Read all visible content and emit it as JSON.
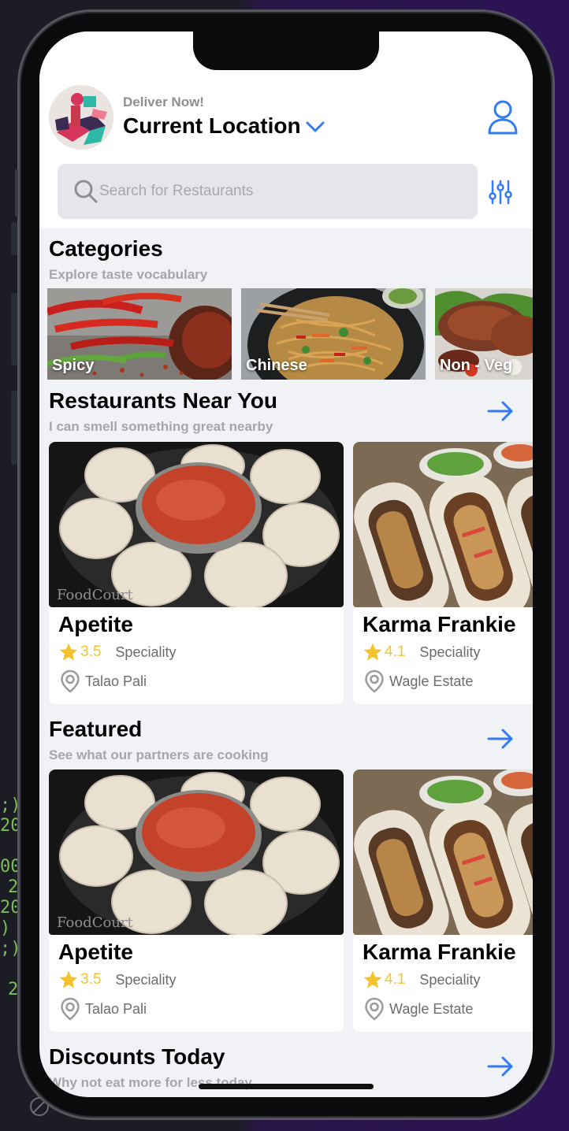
{
  "header": {
    "deliver_label": "Deliver Now!",
    "location": "Current Location",
    "search_placeholder": "Search for Restaurants"
  },
  "categories": {
    "title": "Categories",
    "subtitle": "Explore taste vocabulary",
    "items": [
      {
        "label": "Spicy"
      },
      {
        "label": "Chinese"
      },
      {
        "label": "Non - Veg"
      }
    ]
  },
  "nearby": {
    "title": "Restaurants Near You",
    "subtitle": "I can smell something great nearby",
    "cards": [
      {
        "name": "Apetite",
        "rating": "3.5",
        "tag": "Speciality",
        "location": "Talao Pali"
      },
      {
        "name": "Karma Frankie",
        "rating": "4.1",
        "tag": "Speciality",
        "location": "Wagle Estate"
      }
    ]
  },
  "featured": {
    "title": "Featured",
    "subtitle": "See what our partners are cooking",
    "cards": [
      {
        "name": "Apetite",
        "rating": "3.5",
        "tag": "Speciality",
        "location": "Talao Pali"
      },
      {
        "name": "Karma Frankie",
        "rating": "4.1",
        "tag": "Speciality",
        "location": "Wagle Estate"
      }
    ]
  },
  "discounts": {
    "title": "Discounts Today",
    "subtitle": "Why not eat more for less today"
  },
  "editor_fragments": [
    ";)",
    "20",
    "00",
    "2",
    "20",
    ")",
    ";)",
    "2"
  ],
  "colors": {
    "accent": "#2f7cf6",
    "star": "#f4c430",
    "subtitle": "#a5a5ab",
    "screen_bg": "#f1f2f6"
  }
}
